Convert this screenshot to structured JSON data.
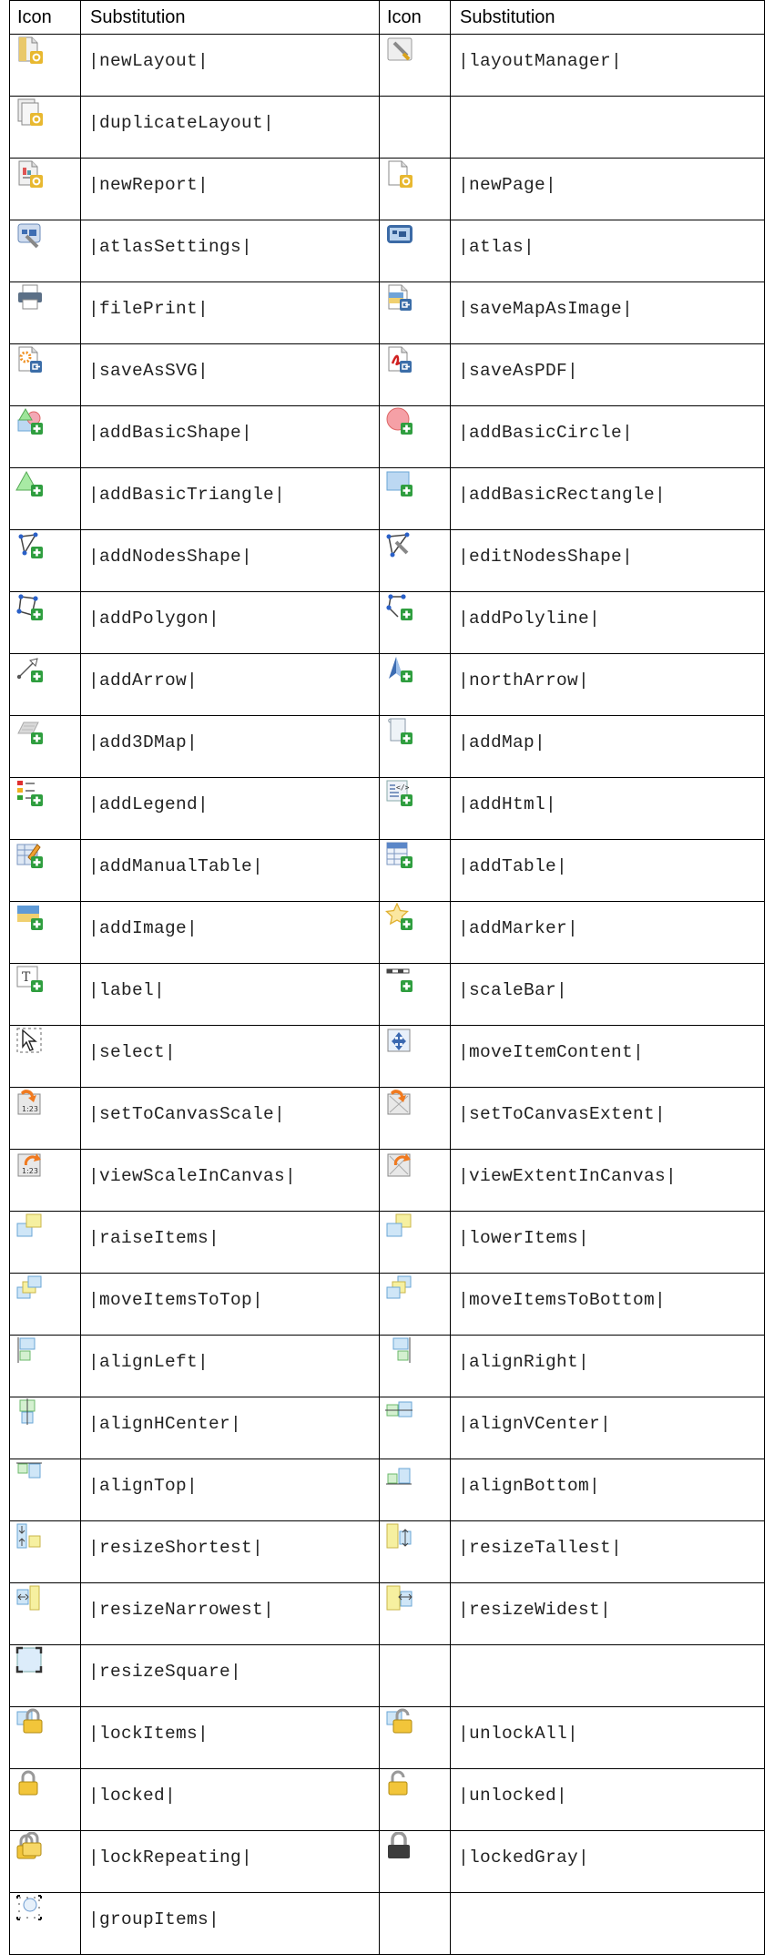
{
  "header": {
    "col1": "Icon",
    "col2": "Substitution",
    "col3": "Icon",
    "col4": "Substitution"
  },
  "rows": [
    {
      "left": {
        "icon": "new-layout-icon",
        "text": "|newLayout|"
      },
      "right": {
        "icon": "layout-manager-icon",
        "text": "|layoutManager|"
      }
    },
    {
      "left": {
        "icon": "duplicate-layout-icon",
        "text": "|duplicateLayout|"
      },
      "right": {
        "icon": "",
        "text": ""
      }
    },
    {
      "left": {
        "icon": "new-report-icon",
        "text": "|newReport|"
      },
      "right": {
        "icon": "new-page-icon",
        "text": "|newPage|"
      }
    },
    {
      "left": {
        "icon": "atlas-settings-icon",
        "text": "|atlasSettings|"
      },
      "right": {
        "icon": "atlas-icon",
        "text": "|atlas|"
      }
    },
    {
      "left": {
        "icon": "file-print-icon",
        "text": "|filePrint|"
      },
      "right": {
        "icon": "save-map-as-image-icon",
        "text": "|saveMapAsImage|"
      }
    },
    {
      "left": {
        "icon": "save-as-svg-icon",
        "text": "|saveAsSVG|"
      },
      "right": {
        "icon": "save-as-pdf-icon",
        "text": "|saveAsPDF|"
      }
    },
    {
      "left": {
        "icon": "add-basic-shape-icon",
        "text": "|addBasicShape|"
      },
      "right": {
        "icon": "add-basic-circle-icon",
        "text": "|addBasicCircle|"
      }
    },
    {
      "left": {
        "icon": "add-basic-triangle-icon",
        "text": "|addBasicTriangle|"
      },
      "right": {
        "icon": "add-basic-rectangle-icon",
        "text": "|addBasicRectangle|"
      }
    },
    {
      "left": {
        "icon": "add-nodes-shape-icon",
        "text": "|addNodesShape|"
      },
      "right": {
        "icon": "edit-nodes-shape-icon",
        "text": "|editNodesShape|"
      }
    },
    {
      "left": {
        "icon": "add-polygon-icon",
        "text": "|addPolygon|"
      },
      "right": {
        "icon": "add-polyline-icon",
        "text": "|addPolyline|"
      }
    },
    {
      "left": {
        "icon": "add-arrow-icon",
        "text": "|addArrow|"
      },
      "right": {
        "icon": "north-arrow-icon",
        "text": "|northArrow|"
      }
    },
    {
      "left": {
        "icon": "add-3d-map-icon",
        "text": "|add3DMap|"
      },
      "right": {
        "icon": "add-map-icon",
        "text": "|addMap|"
      }
    },
    {
      "left": {
        "icon": "add-legend-icon",
        "text": "|addLegend|"
      },
      "right": {
        "icon": "add-html-icon",
        "text": "|addHtml|"
      }
    },
    {
      "left": {
        "icon": "add-manual-table-icon",
        "text": "|addManualTable|"
      },
      "right": {
        "icon": "add-table-icon",
        "text": "|addTable|"
      }
    },
    {
      "left": {
        "icon": "add-image-icon",
        "text": "|addImage|"
      },
      "right": {
        "icon": "add-marker-icon",
        "text": "|addMarker|"
      }
    },
    {
      "left": {
        "icon": "label-icon",
        "text": "|label|"
      },
      "right": {
        "icon": "scale-bar-icon",
        "text": "|scaleBar|"
      }
    },
    {
      "left": {
        "icon": "select-icon",
        "text": "|select|"
      },
      "right": {
        "icon": "move-item-content-icon",
        "text": "|moveItemContent|"
      }
    },
    {
      "left": {
        "icon": "set-to-canvas-scale-icon",
        "text": "|setToCanvasScale|"
      },
      "right": {
        "icon": "set-to-canvas-extent-icon",
        "text": "|setToCanvasExtent|"
      }
    },
    {
      "left": {
        "icon": "view-scale-in-canvas-icon",
        "text": "|viewScaleInCanvas|"
      },
      "right": {
        "icon": "view-extent-in-canvas-icon",
        "text": "|viewExtentInCanvas|"
      }
    },
    {
      "left": {
        "icon": "raise-items-icon",
        "text": "|raiseItems|"
      },
      "right": {
        "icon": "lower-items-icon",
        "text": "|lowerItems|"
      }
    },
    {
      "left": {
        "icon": "move-items-to-top-icon",
        "text": "|moveItemsToTop|"
      },
      "right": {
        "icon": "move-items-to-bottom-icon",
        "text": "|moveItemsToBottom|"
      }
    },
    {
      "left": {
        "icon": "align-left-icon",
        "text": "|alignLeft|"
      },
      "right": {
        "icon": "align-right-icon",
        "text": "|alignRight|"
      }
    },
    {
      "left": {
        "icon": "align-h-center-icon",
        "text": "|alignHCenter|"
      },
      "right": {
        "icon": "align-v-center-icon",
        "text": "|alignVCenter|"
      }
    },
    {
      "left": {
        "icon": "align-top-icon",
        "text": "|alignTop|"
      },
      "right": {
        "icon": "align-bottom-icon",
        "text": "|alignBottom|"
      }
    },
    {
      "left": {
        "icon": "resize-shortest-icon",
        "text": "|resizeShortest|"
      },
      "right": {
        "icon": "resize-tallest-icon",
        "text": "|resizeTallest|"
      }
    },
    {
      "left": {
        "icon": "resize-narrowest-icon",
        "text": "|resizeNarrowest|"
      },
      "right": {
        "icon": "resize-widest-icon",
        "text": "|resizeWidest|"
      }
    },
    {
      "left": {
        "icon": "resize-square-icon",
        "text": "|resizeSquare|"
      },
      "right": {
        "icon": "",
        "text": ""
      }
    },
    {
      "left": {
        "icon": "lock-items-icon",
        "text": "|lockItems|"
      },
      "right": {
        "icon": "unlock-all-icon",
        "text": "|unlockAll|"
      }
    },
    {
      "left": {
        "icon": "locked-icon",
        "text": "|locked|"
      },
      "right": {
        "icon": "unlocked-icon",
        "text": "|unlocked|"
      }
    },
    {
      "left": {
        "icon": "lock-repeating-icon",
        "text": "|lockRepeating|"
      },
      "right": {
        "icon": "locked-gray-icon",
        "text": "|lockedGray|"
      }
    },
    {
      "left": {
        "icon": "group-items-icon",
        "text": "|groupItems|"
      },
      "right": {
        "icon": "",
        "text": ""
      }
    }
  ]
}
